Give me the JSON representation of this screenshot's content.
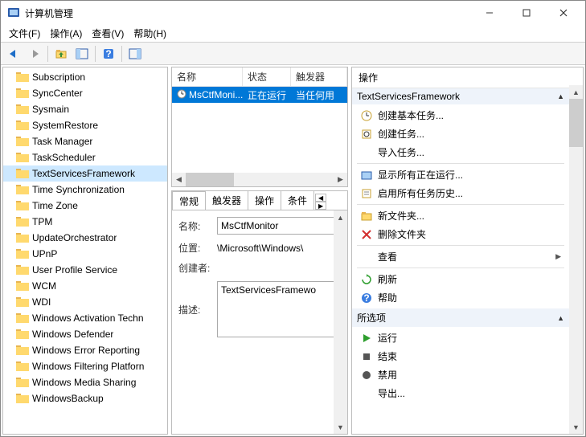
{
  "window": {
    "title": "计算机管理"
  },
  "menu": {
    "file": "文件(F)",
    "action": "操作(A)",
    "view": "查看(V)",
    "help": "帮助(H)"
  },
  "tree": {
    "items": [
      {
        "label": "Subscription"
      },
      {
        "label": "SyncCenter"
      },
      {
        "label": "Sysmain"
      },
      {
        "label": "SystemRestore"
      },
      {
        "label": "Task Manager"
      },
      {
        "label": "TaskScheduler"
      },
      {
        "label": "TextServicesFramework",
        "selected": true
      },
      {
        "label": "Time Synchronization"
      },
      {
        "label": "Time Zone"
      },
      {
        "label": "TPM"
      },
      {
        "label": "UpdateOrchestrator"
      },
      {
        "label": "UPnP"
      },
      {
        "label": "User Profile Service"
      },
      {
        "label": "WCM"
      },
      {
        "label": "WDI"
      },
      {
        "label": "Windows Activation Techn"
      },
      {
        "label": "Windows Defender"
      },
      {
        "label": "Windows Error Reporting"
      },
      {
        "label": "Windows Filtering Platforn"
      },
      {
        "label": "Windows Media Sharing"
      },
      {
        "label": "WindowsBackup"
      }
    ]
  },
  "list": {
    "cols": {
      "name": "名称",
      "status": "状态",
      "trigger": "触发器"
    },
    "row": {
      "name": "MsCtfMoni...",
      "status": "正在运行",
      "trigger": "当任何用"
    }
  },
  "tabs": {
    "general": "常规",
    "triggers": "触发器",
    "actions": "操作",
    "conditions": "条件"
  },
  "props": {
    "name_label": "名称:",
    "name_value": "MsCtfMonitor",
    "location_label": "位置:",
    "location_value": "\\Microsoft\\Windows\\",
    "author_label": "创建者:",
    "author_value": "",
    "desc_label": "描述:",
    "desc_value": "TextServicesFramewo"
  },
  "actions": {
    "header": "操作",
    "section1_title": "TextServicesFramework",
    "items1": {
      "create_basic": "创建基本任务...",
      "create": "创建任务...",
      "import": "导入任务...",
      "show_running": "显示所有正在运行...",
      "enable_history": "启用所有任务历史...",
      "new_folder": "新文件夹...",
      "delete_folder": "删除文件夹",
      "view": "查看",
      "refresh": "刷新",
      "help": "帮助"
    },
    "section2_title": "所选项",
    "items2": {
      "run": "运行",
      "end": "结束",
      "disable": "禁用",
      "export": "导出..."
    }
  }
}
